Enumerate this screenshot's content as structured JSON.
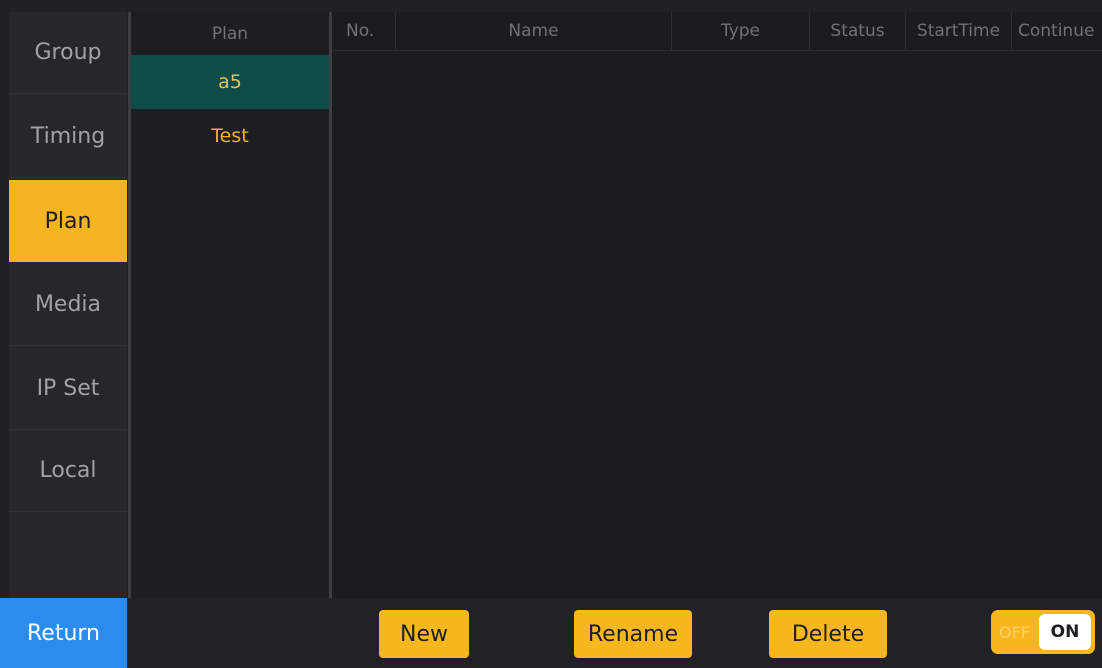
{
  "nav": {
    "items": [
      {
        "label": "Group"
      },
      {
        "label": "Timing"
      },
      {
        "label": "Plan"
      },
      {
        "label": "Media"
      },
      {
        "label": "IP Set"
      },
      {
        "label": "Local"
      }
    ],
    "active": "Plan"
  },
  "plans": {
    "header": "Plan",
    "items": [
      {
        "label": "a5"
      },
      {
        "label": "Test"
      }
    ],
    "selected": "a5"
  },
  "table": {
    "columns": [
      "No.",
      "Name",
      "Type",
      "Status",
      "StartTime",
      "Continue"
    ],
    "rows": []
  },
  "footer": {
    "return_label": "Return",
    "new_label": "New",
    "rename_label": "Rename",
    "delete_label": "Delete",
    "toggle_off": "OFF",
    "toggle_on": "ON",
    "toggle_state": "ON"
  },
  "colors": {
    "accent": "#f8b71f",
    "selected_row": "#0e4c47",
    "return_button": "#2b8cf0",
    "background": "#202126"
  }
}
